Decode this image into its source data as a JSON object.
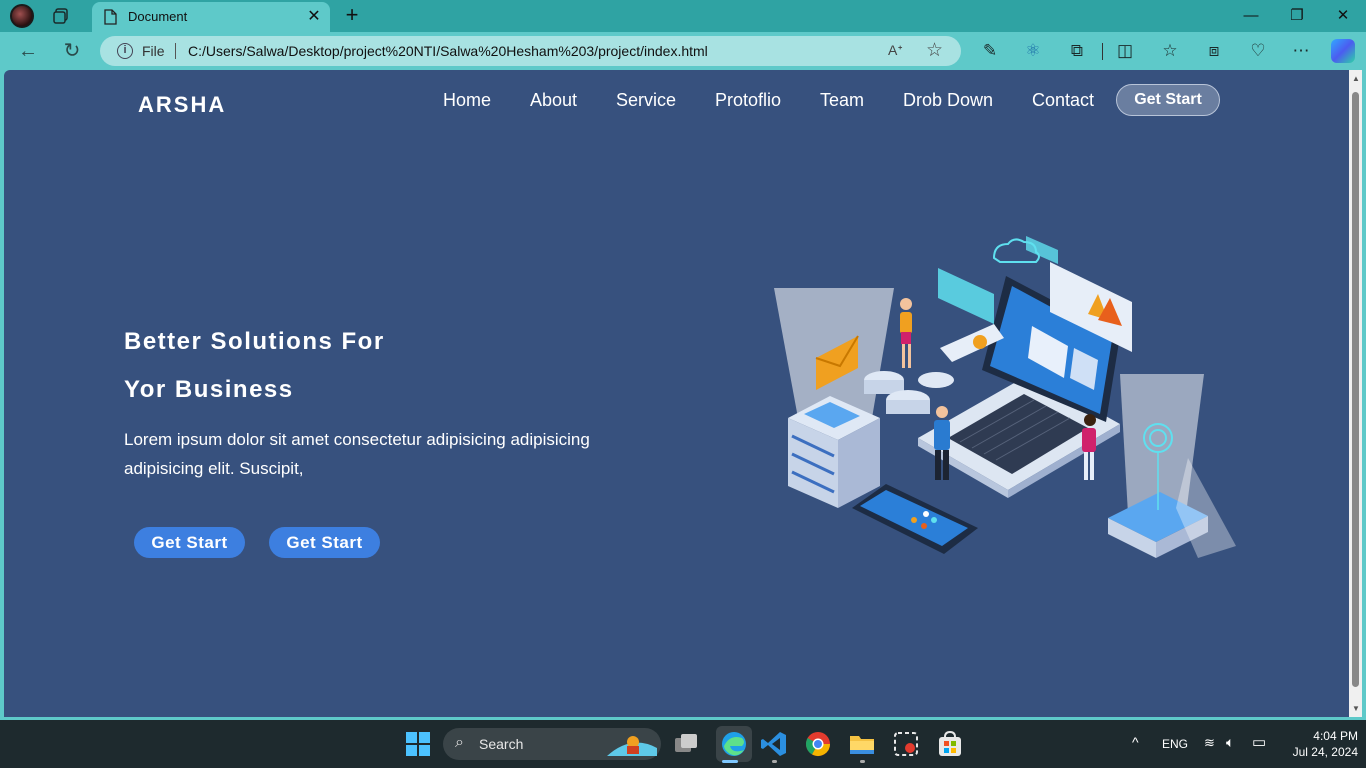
{
  "browser": {
    "tab_title": "Document",
    "omnibox": {
      "scheme_label": "File",
      "url": "C:/Users/Salwa/Desktop/project%20NTI/Salwa%20Hesham%203/project/index.html"
    }
  },
  "page": {
    "logo": "ARSHA",
    "nav": [
      "Home",
      "About",
      "Service",
      "Protoflio",
      "Team",
      "Drob Down",
      "Contact"
    ],
    "nav_cta": "Get Start",
    "hero": {
      "title_line1": "Better Solutions For",
      "title_line2": "Yor Business",
      "text": "Lorem ipsum dolor sit amet consectetur adipisicing adipisicing adipisicing elit. Suscipit,",
      "button1": "Get Start",
      "button2": "Get Start"
    },
    "colors": {
      "background": "#37517e",
      "accent_button": "#3d7fe0"
    }
  },
  "taskbar": {
    "search_label": "Search",
    "language": "ENG",
    "time": "4:04 PM",
    "date": "Jul 24, 2024",
    "apps": [
      "windows-start-icon",
      "task-view-icon",
      "edge-icon",
      "vscode-icon",
      "chrome-icon",
      "file-explorer-icon",
      "snipping-tool-icon",
      "microsoft-store-icon"
    ]
  }
}
